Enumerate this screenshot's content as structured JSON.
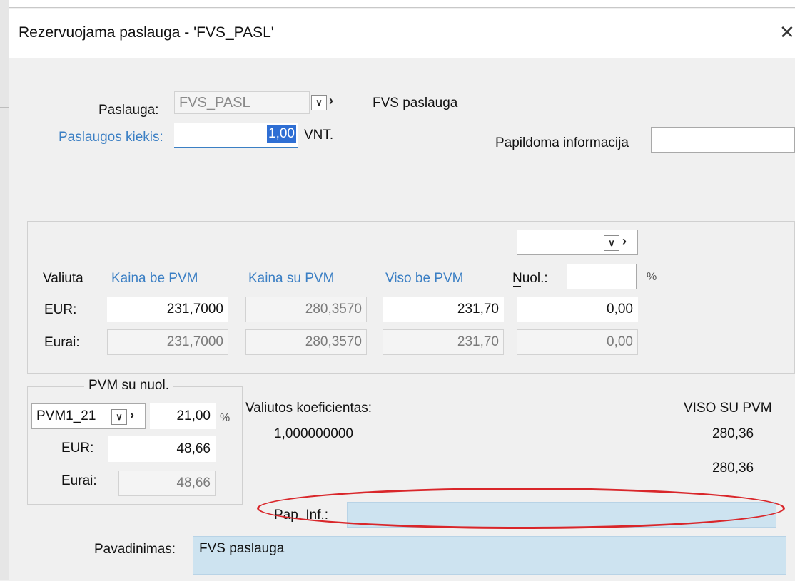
{
  "window": {
    "title": "Rezervuojama paslauga - 'FVS_PASL'",
    "close_glyph": "✕"
  },
  "paslauga": {
    "label": "Paslauga:",
    "code": "FVS_PASL",
    "name": "FVS paslauga"
  },
  "kiekis": {
    "label": "Paslaugos kiekis:",
    "value": "1,00",
    "unit": "VNT."
  },
  "papildoma": {
    "label": "Papildoma informacija",
    "value": ""
  },
  "price_table": {
    "col_valiuta": "Valiuta",
    "col_kaina_be": "Kaina be PVM",
    "col_kaina_su": "Kaina su PVM",
    "col_viso_be": "Viso be PVM",
    "nuol_label": "Nuol.:",
    "nuol_value": "",
    "percent": "%",
    "rows": [
      {
        "currency": "EUR:",
        "kaina_be": "231,7000",
        "kaina_su": "280,3570",
        "viso_be": "231,70",
        "nuol": "0,00"
      },
      {
        "currency": "Eurai:",
        "kaina_be": "231,7000",
        "kaina_su": "280,3570",
        "viso_be": "231,70",
        "nuol": "0,00"
      }
    ]
  },
  "pvm": {
    "group_label": "PVM su nuol.",
    "code": "PVM1_21",
    "rate": "21,00",
    "percent": "%",
    "eur_label": "EUR:",
    "eur_value": "48,66",
    "eurai_label": "Eurai:",
    "eurai_value": "48,66"
  },
  "koeficientas": {
    "label": "Valiutos koeficientas:",
    "value": "1,000000000"
  },
  "viso_su_pvm": {
    "label": "VISO SU PVM",
    "eur": "280,36",
    "eurai": "280,36"
  },
  "pap_inf": {
    "label": "Pap. Inf.:",
    "value": ""
  },
  "pavadinimas": {
    "label": "Pavadinimas:",
    "value": "FVS paslauga"
  },
  "colors": {
    "label_blue": "#3b7fc4",
    "highlight": "#cde3f0",
    "ellipse_red": "#d9262a"
  }
}
